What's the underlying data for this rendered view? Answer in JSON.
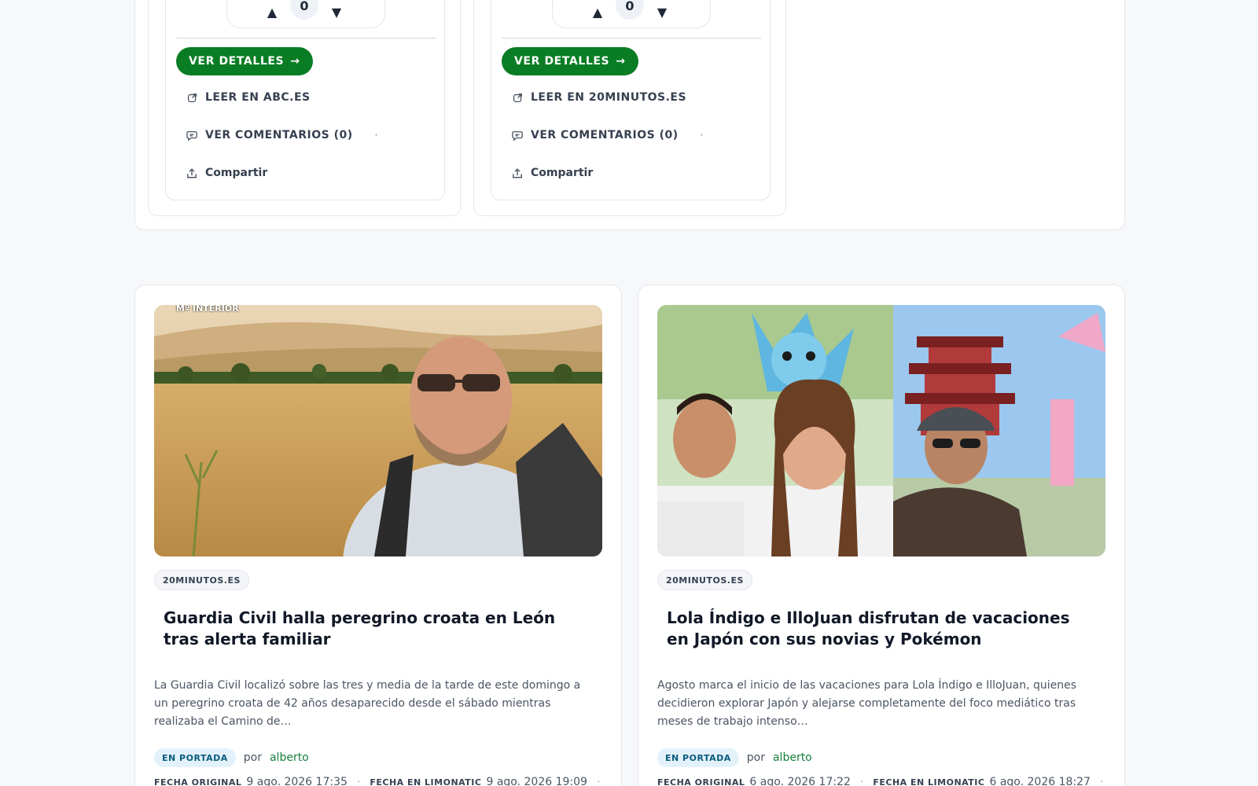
{
  "top_cards": [
    {
      "votes": 0,
      "up_symbol": "▲",
      "down_symbol": "▼",
      "details_label": "VER DETALLES",
      "arrow": "→",
      "read_label": "LEER EN ABC.ES",
      "comments_label": "VER COMENTARIOS (0)",
      "separator": "·",
      "share_label": "Compartir"
    },
    {
      "votes": 0,
      "up_symbol": "▲",
      "down_symbol": "▼",
      "details_label": "VER DETALLES",
      "arrow": "→",
      "read_label": "LEER EN 20MINUTOS.ES",
      "comments_label": "VER COMENTARIOS (0)",
      "separator": "·",
      "share_label": "Compartir"
    }
  ],
  "news": [
    {
      "source": "20MINUTOS.ES",
      "title": "Guardia Civil halla peregrino croata en León tras alerta familiar",
      "excerpt": "La Guardia Civil localizó sobre las tres y media de la tarde de este domingo a un peregrino croata de 42 años desaparecido desde el sábado mientras realizaba el Camino de…",
      "portada": "EN PORTADA",
      "por": "por",
      "author": "alberto",
      "original_label": "FECHA ORIGINAL",
      "original_date": "9 ago. 2026 17:35",
      "limonatic_label": "FECHA EN LIMONATIC",
      "limonatic_date": "9 ago. 2026 19:09",
      "dot": "·",
      "image_watermark": "Mº INTERIOR"
    },
    {
      "source": "20MINUTOS.ES",
      "title": "Lola Índigo e IlloJuan disfrutan de vacaciones en Japón con sus novias y Pokémon",
      "excerpt": "Agosto marca el inicio de las vacaciones para Lola Índigo e IlloJuan, quienes decidieron explorar Japón y alejarse completamente del foco mediático tras meses de trabajo intenso…",
      "portada": "EN PORTADA",
      "por": "por",
      "author": "alberto",
      "original_label": "FECHA ORIGINAL",
      "original_date": "6 ago. 2026 17:22",
      "limonatic_label": "FECHA EN LIMONATIC",
      "limonatic_date": "6 ago. 2026 18:27",
      "dot": "·"
    }
  ],
  "colors": {
    "primary_green": "#0a7d24",
    "author_green": "#16803c",
    "portada_bg": "#e3f1fb",
    "portada_text": "#0a5c7d"
  },
  "icons": {
    "external_link": "external-link-icon",
    "comments": "comment-icon",
    "share": "share-icon"
  }
}
